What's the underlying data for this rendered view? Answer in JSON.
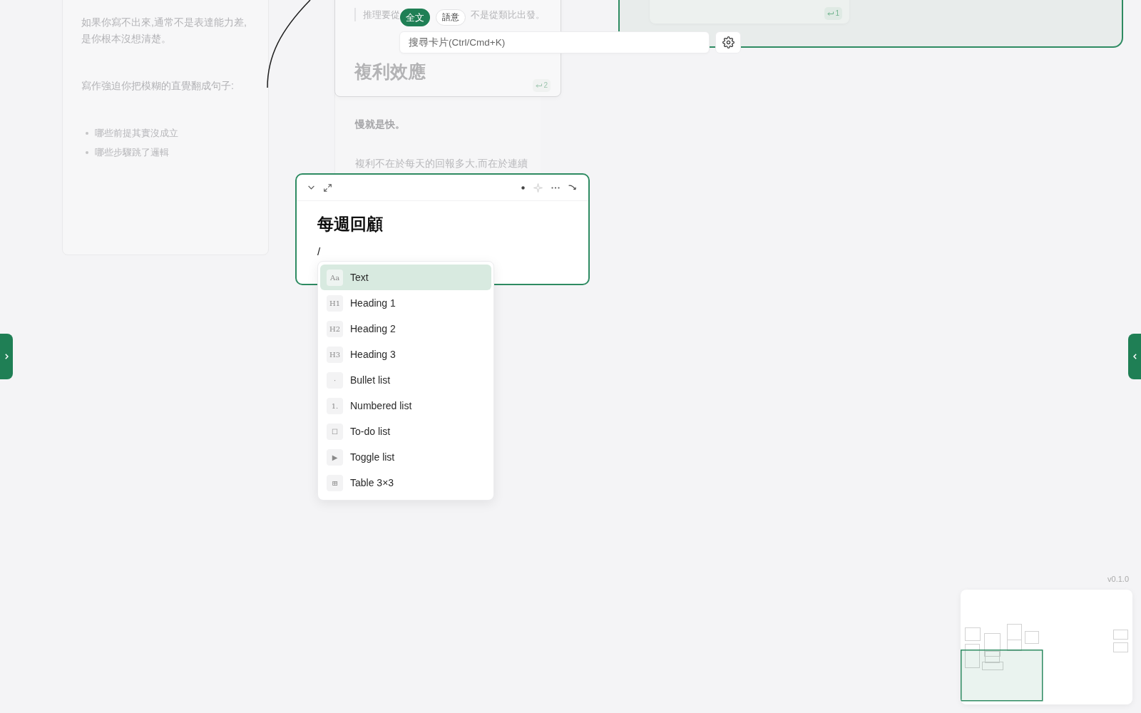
{
  "canvas": {
    "left_card": {
      "paragraphs": [
        {
          "lines": [
            "如果你寫不出來,通常不是表達能力差,",
            "是你根本沒想清楚。"
          ]
        },
        {
          "lines": [
            "寫作強迫你把模糊的直覺翻成句子:"
          ]
        }
      ],
      "bullets": [
        "哪些前提其實沒成立",
        "哪些步驟跳了邏輯"
      ]
    },
    "compound_card": {
      "embedded_card": {
        "quote_fragments": [
          "推理要從",
          "不是從類比出發。"
        ],
        "title": "複利效應",
        "backlink_count": "2"
      },
      "paragraphs": [
        {
          "text": "慢就是快。",
          "bold": true
        },
        {
          "text": "複利不在於每天的回報多大,而在於連續",
          "bold": false
        }
      ]
    },
    "linked_card": {
      "selected": true,
      "embedded_card": {
        "backlink_count": "1"
      }
    },
    "editor": {
      "selected": true,
      "title": "每週回顧",
      "input": "/"
    },
    "slash_menu": {
      "items": [
        {
          "glyph": "Aa",
          "label": "Text",
          "selected": true
        },
        {
          "glyph": "H1",
          "label": "Heading 1",
          "selected": false
        },
        {
          "glyph": "H2",
          "label": "Heading 2",
          "selected": false
        },
        {
          "glyph": "H3",
          "label": "Heading 3",
          "selected": false
        },
        {
          "glyph": "·",
          "label": "Bullet list",
          "selected": false
        },
        {
          "glyph": "1.",
          "label": "Numbered list",
          "selected": false
        },
        {
          "glyph": "☐",
          "label": "To-do list",
          "selected": false
        },
        {
          "glyph": "▶",
          "label": "Toggle list",
          "selected": false
        },
        {
          "glyph": "⊞",
          "label": "Table 3×3",
          "selected": false
        }
      ]
    }
  },
  "search": {
    "modes": [
      {
        "label": "全文",
        "selected": true
      },
      {
        "label": "語意",
        "selected": false
      }
    ],
    "placeholder": "搜尋卡片(Ctrl/Cmd+K)"
  },
  "version": "v0.1.0"
}
